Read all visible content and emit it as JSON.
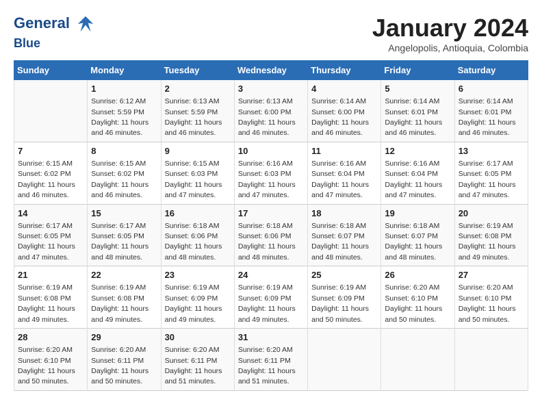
{
  "header": {
    "logo_line1": "General",
    "logo_line2": "Blue",
    "month_title": "January 2024",
    "subtitle": "Angelopolis, Antioquia, Colombia"
  },
  "weekdays": [
    "Sunday",
    "Monday",
    "Tuesday",
    "Wednesday",
    "Thursday",
    "Friday",
    "Saturday"
  ],
  "weeks": [
    [
      {
        "day": "",
        "info": ""
      },
      {
        "day": "1",
        "info": "Sunrise: 6:12 AM\nSunset: 5:59 PM\nDaylight: 11 hours\nand 46 minutes."
      },
      {
        "day": "2",
        "info": "Sunrise: 6:13 AM\nSunset: 5:59 PM\nDaylight: 11 hours\nand 46 minutes."
      },
      {
        "day": "3",
        "info": "Sunrise: 6:13 AM\nSunset: 6:00 PM\nDaylight: 11 hours\nand 46 minutes."
      },
      {
        "day": "4",
        "info": "Sunrise: 6:14 AM\nSunset: 6:00 PM\nDaylight: 11 hours\nand 46 minutes."
      },
      {
        "day": "5",
        "info": "Sunrise: 6:14 AM\nSunset: 6:01 PM\nDaylight: 11 hours\nand 46 minutes."
      },
      {
        "day": "6",
        "info": "Sunrise: 6:14 AM\nSunset: 6:01 PM\nDaylight: 11 hours\nand 46 minutes."
      }
    ],
    [
      {
        "day": "7",
        "info": "Sunrise: 6:15 AM\nSunset: 6:02 PM\nDaylight: 11 hours\nand 46 minutes."
      },
      {
        "day": "8",
        "info": "Sunrise: 6:15 AM\nSunset: 6:02 PM\nDaylight: 11 hours\nand 46 minutes."
      },
      {
        "day": "9",
        "info": "Sunrise: 6:15 AM\nSunset: 6:03 PM\nDaylight: 11 hours\nand 47 minutes."
      },
      {
        "day": "10",
        "info": "Sunrise: 6:16 AM\nSunset: 6:03 PM\nDaylight: 11 hours\nand 47 minutes."
      },
      {
        "day": "11",
        "info": "Sunrise: 6:16 AM\nSunset: 6:04 PM\nDaylight: 11 hours\nand 47 minutes."
      },
      {
        "day": "12",
        "info": "Sunrise: 6:16 AM\nSunset: 6:04 PM\nDaylight: 11 hours\nand 47 minutes."
      },
      {
        "day": "13",
        "info": "Sunrise: 6:17 AM\nSunset: 6:05 PM\nDaylight: 11 hours\nand 47 minutes."
      }
    ],
    [
      {
        "day": "14",
        "info": "Sunrise: 6:17 AM\nSunset: 6:05 PM\nDaylight: 11 hours\nand 47 minutes."
      },
      {
        "day": "15",
        "info": "Sunrise: 6:17 AM\nSunset: 6:05 PM\nDaylight: 11 hours\nand 48 minutes."
      },
      {
        "day": "16",
        "info": "Sunrise: 6:18 AM\nSunset: 6:06 PM\nDaylight: 11 hours\nand 48 minutes."
      },
      {
        "day": "17",
        "info": "Sunrise: 6:18 AM\nSunset: 6:06 PM\nDaylight: 11 hours\nand 48 minutes."
      },
      {
        "day": "18",
        "info": "Sunrise: 6:18 AM\nSunset: 6:07 PM\nDaylight: 11 hours\nand 48 minutes."
      },
      {
        "day": "19",
        "info": "Sunrise: 6:18 AM\nSunset: 6:07 PM\nDaylight: 11 hours\nand 48 minutes."
      },
      {
        "day": "20",
        "info": "Sunrise: 6:19 AM\nSunset: 6:08 PM\nDaylight: 11 hours\nand 49 minutes."
      }
    ],
    [
      {
        "day": "21",
        "info": "Sunrise: 6:19 AM\nSunset: 6:08 PM\nDaylight: 11 hours\nand 49 minutes."
      },
      {
        "day": "22",
        "info": "Sunrise: 6:19 AM\nSunset: 6:08 PM\nDaylight: 11 hours\nand 49 minutes."
      },
      {
        "day": "23",
        "info": "Sunrise: 6:19 AM\nSunset: 6:09 PM\nDaylight: 11 hours\nand 49 minutes."
      },
      {
        "day": "24",
        "info": "Sunrise: 6:19 AM\nSunset: 6:09 PM\nDaylight: 11 hours\nand 49 minutes."
      },
      {
        "day": "25",
        "info": "Sunrise: 6:19 AM\nSunset: 6:09 PM\nDaylight: 11 hours\nand 50 minutes."
      },
      {
        "day": "26",
        "info": "Sunrise: 6:20 AM\nSunset: 6:10 PM\nDaylight: 11 hours\nand 50 minutes."
      },
      {
        "day": "27",
        "info": "Sunrise: 6:20 AM\nSunset: 6:10 PM\nDaylight: 11 hours\nand 50 minutes."
      }
    ],
    [
      {
        "day": "28",
        "info": "Sunrise: 6:20 AM\nSunset: 6:10 PM\nDaylight: 11 hours\nand 50 minutes."
      },
      {
        "day": "29",
        "info": "Sunrise: 6:20 AM\nSunset: 6:11 PM\nDaylight: 11 hours\nand 50 minutes."
      },
      {
        "day": "30",
        "info": "Sunrise: 6:20 AM\nSunset: 6:11 PM\nDaylight: 11 hours\nand 51 minutes."
      },
      {
        "day": "31",
        "info": "Sunrise: 6:20 AM\nSunset: 6:11 PM\nDaylight: 11 hours\nand 51 minutes."
      },
      {
        "day": "",
        "info": ""
      },
      {
        "day": "",
        "info": ""
      },
      {
        "day": "",
        "info": ""
      }
    ]
  ]
}
